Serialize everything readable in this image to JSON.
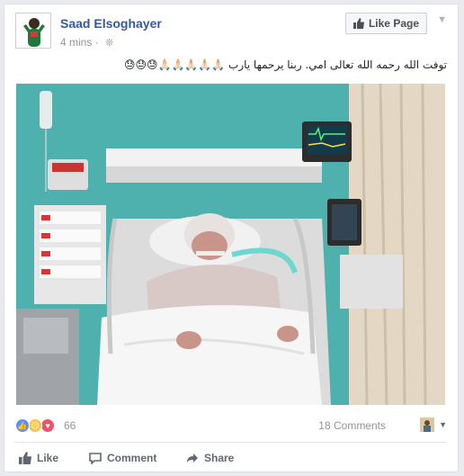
{
  "post": {
    "author": "Saad Elsoghayer",
    "time": "4 mins",
    "privacy_icon": "globe-icon",
    "text": "توفت الله رحمه الله تعالى امي. ربنا يرحمها يارب 🙏🏻🙏🏻🙏🏻🙏🏻🙏🏻😓😓😓",
    "like_page_label": "Like Page"
  },
  "stats": {
    "reaction_count": "66",
    "reaction_icons": [
      "like-icon",
      "sad-icon",
      "love-icon"
    ],
    "comments": "18 Comments"
  },
  "actions": {
    "like": "Like",
    "comment": "Comment",
    "share": "Share"
  },
  "colors": {
    "brand_blue": "#365899",
    "like_blue": "#5890ff",
    "love_red": "#f25268",
    "sad_yellow": "#f7c64a"
  }
}
